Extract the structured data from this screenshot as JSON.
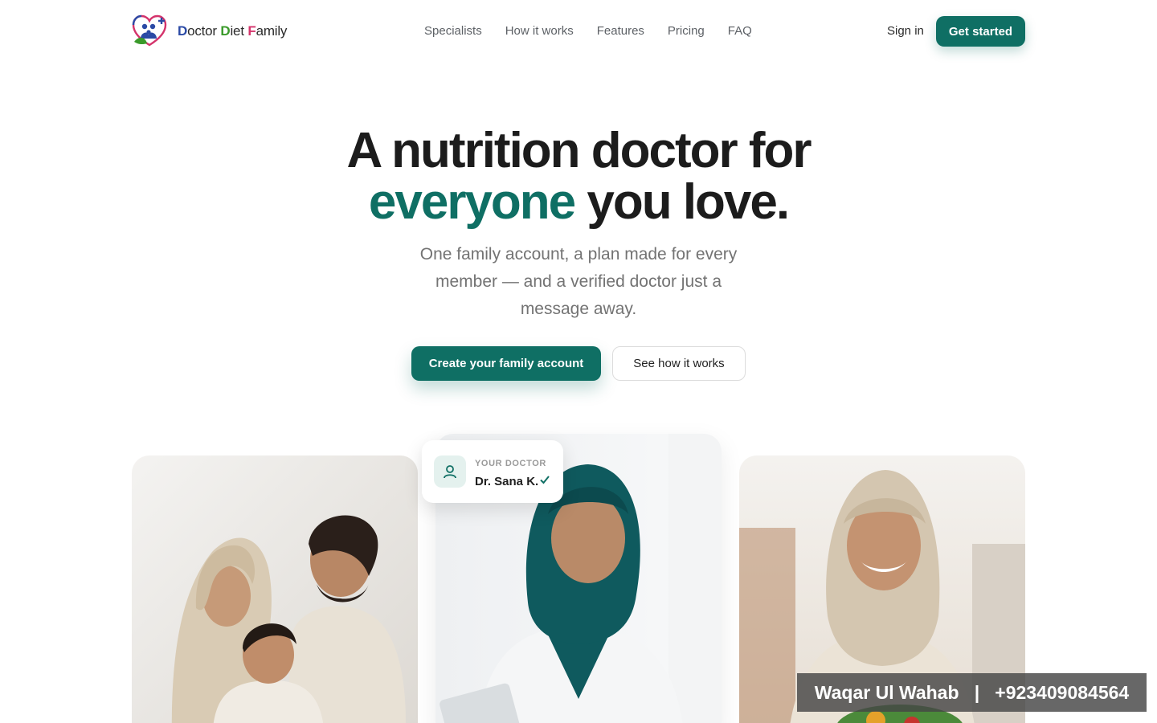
{
  "brand": {
    "name_part1": "D",
    "name_part2": "octor ",
    "name_part3": "D",
    "name_part4": "iet ",
    "name_part5": "F",
    "name_part6": "amily",
    "logo_icon": "heart-family-logo-icon"
  },
  "nav": {
    "links": [
      "Specialists",
      "How it works",
      "Features",
      "Pricing",
      "FAQ"
    ],
    "sign_in": "Sign in",
    "get_started": "Get started"
  },
  "hero": {
    "title_line1": "A nutrition doctor for",
    "title_accent": "everyone",
    "title_line2_rest": " you love.",
    "subtitle": "One family account, a plan made for every member — and a verified doctor just a message away.",
    "cta_primary": "Create your family account",
    "cta_secondary": "See how it works"
  },
  "doctor_badge": {
    "label": "YOUR DOCTOR",
    "name": "Dr. Sana K.",
    "icon": "user-icon",
    "verified_icon": "checkmark-icon"
  },
  "watermark": {
    "text": "Waqar Ul Wahab   |   +923409084564"
  },
  "colors": {
    "accent": "#0f6f64",
    "brand_blue": "#2b4aa5",
    "brand_green": "#3a9a2a",
    "brand_pink": "#d4336b",
    "muted_text": "#737373"
  }
}
